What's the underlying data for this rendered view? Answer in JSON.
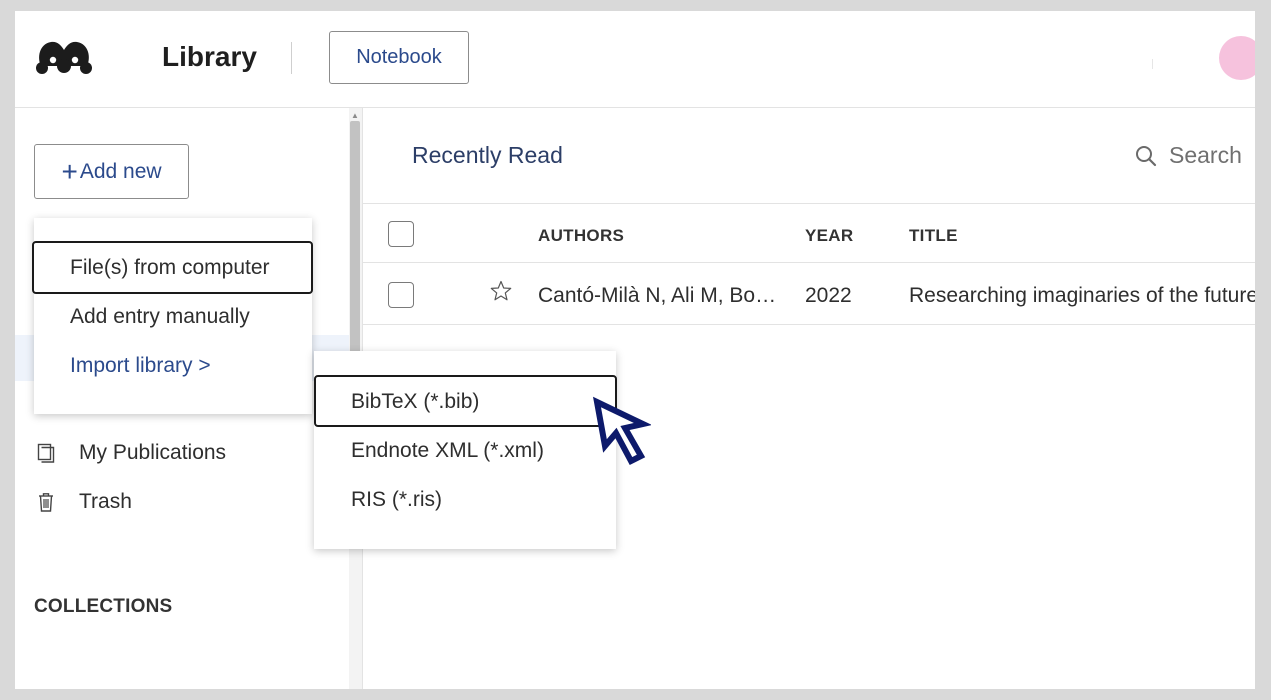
{
  "header": {
    "title": "Library",
    "notebook_label": "Notebook"
  },
  "sidebar": {
    "add_new_label": "Add new",
    "items": [
      {
        "label": "My Publications",
        "icon": "publications-icon"
      },
      {
        "label": "Trash",
        "icon": "trash-icon"
      }
    ],
    "collections_heading": "COLLECTIONS"
  },
  "add_new_menu": {
    "items": [
      {
        "label": "File(s) from computer"
      },
      {
        "label": "Add entry manually"
      },
      {
        "label": "Import library >"
      }
    ]
  },
  "import_submenu": {
    "items": [
      {
        "label": "BibTeX (*.bib)"
      },
      {
        "label": "Endnote XML (*.xml)"
      },
      {
        "label": "RIS (*.ris)"
      }
    ]
  },
  "main": {
    "section_title": "Recently Read",
    "search_label": "Search",
    "columns": [
      "AUTHORS",
      "YEAR",
      "TITLE"
    ],
    "rows": [
      {
        "authors": "Cantó-Milà N, Ali M, Bo…",
        "year": "2022",
        "title": "Researching imaginaries of the future"
      }
    ]
  },
  "colors": {
    "accent": "#2b4a8c",
    "avatar": "#f6c2dd",
    "cursor": "#0d1a6b"
  }
}
